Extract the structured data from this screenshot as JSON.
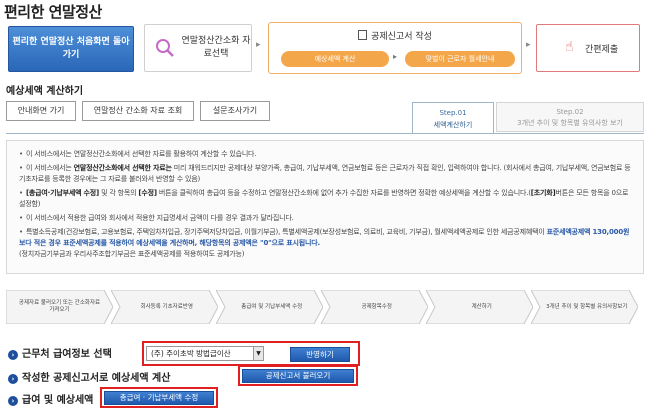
{
  "header": {
    "title": "편리한 연말정산"
  },
  "steps": {
    "first_page": "편리한 연말정산 처음화면 돌아가기",
    "select": "연말정산간소화 자료선택",
    "write": "공제신고서 작성",
    "sub_calc": "예상세액 계산",
    "sub_rent": "맞벌이 근로자 월세안내",
    "submit": "간편제출"
  },
  "section": {
    "title": "예상세액 계산하기"
  },
  "buttons": {
    "guide": "안내화면 가기",
    "view": "연말정산 간소화 자료 조회",
    "survey": "설문조사가기"
  },
  "tabs": {
    "step1_num": "Step.01",
    "step1_label": "세액계산하기",
    "step2_num": "Step.02",
    "step2_label": "3개년 추이 및 항목별 유의사항 보기"
  },
  "info": {
    "p1": "이 서비스에서는 연말정산간소화에서 선택한 자료를 활용하여 계산할 수 있습니다.",
    "p2a": "이 서비스에서는 ",
    "p2b": "연말정산간소화에서 선택한 자료는",
    "p2c": " 미리 채워드리지만 공제대상 부양가족, 총급여, 기납부세액, 연금보험료 등은 근로자가 직접 확인, 입력하여야 합니다. (회사에서 총급여, 기납부세액, 연금보험료 등 기초자료를 등록한 경우에는 그 자료를 불러와서 반영할 수 있음)",
    "p3a": "[총급여·기납부세액 수정]",
    "p3b": " 및 각 항목의 ",
    "p3c": "[수정]",
    "p3d": " 버튼을 클릭하여 총급여 등을 수정하고 연말정산간소화에 없어 추가 수집한 자료를 반영하면 정확한 예상세액을 계산할 수 있습니다.(",
    "p3e": "[초기화]",
    "p3f": "버튼은 모든 항목을 0으로 설정함)",
    "p4": "이 서비스에서 적용한 급여와 회사에서 적용한 지급명세서 금액이 다를 경우 결과가 달라집니다.",
    "p5a": "특별소득공제(건강보험료, 고용보험료, 주택임차차입금, 장기주택저당차입금, 이월기부금), 특별세액공제(보장성보험료, 의료비, 교육비, 기부금), 월세액세액공제로 인한 세금공제혜택이 ",
    "p5b": "표준세액공제액 130,000원보다 적은 경우 표준세액공제를 적용하여 예상세액을 계산하며, 해당항목의 공제액은 \"0\"으로 표시됩니다.",
    "p5c": "(정치자금기부금과 우리사주조합기부금은 표준세액공제를 적용하여도 공제가능)"
  },
  "flow": [
    {
      "label": "공제자료 불러오기 또는 간소화자료 가져오기"
    },
    {
      "label": "회사등록 기초자료반영"
    },
    {
      "label": "총급여 및 기납부세액 수정"
    },
    {
      "label": "공제항목수정"
    },
    {
      "label": "계산하기"
    },
    {
      "label": "3개년 추이 및 항목별 유의사항보기"
    }
  ],
  "actions": {
    "row1_label": "근무처 급여정보 선택",
    "company_value": "(주) 주이초박 방법급이산",
    "apply_btn": "반영하기",
    "row2_label": "작성한 공제신고서로 예상세액 계산",
    "load_btn": "공제신고서 불러오기",
    "row3_label": "급여 및 예상세액",
    "edit_btn": "총급여 · 기납부세액 수정"
  },
  "colors": {
    "accent_blue": "#2a67b8",
    "orange": "#f4a64a",
    "red_highlight": "#e02020"
  }
}
